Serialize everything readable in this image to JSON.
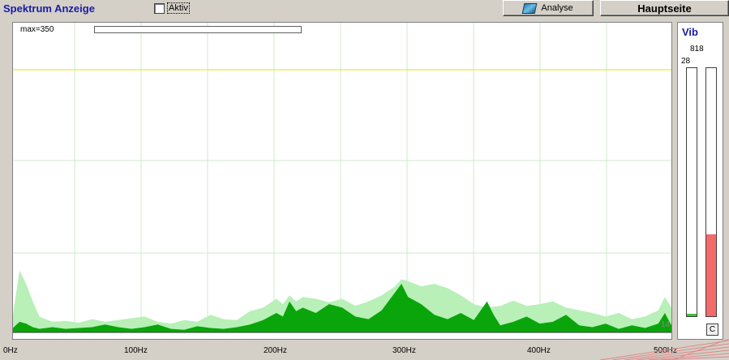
{
  "header": {
    "title": "Spektrum Anzeige",
    "aktiv_label": "Aktiv",
    "analyse_label": "Analyse",
    "hauptseite_label": "Hauptseite"
  },
  "spectrum": {
    "max_label": "max=350",
    "right_value": "14",
    "x_labels": [
      "0Hz",
      "100Hz",
      "200Hz",
      "300Hz",
      "400Hz",
      "500Hz"
    ]
  },
  "vib": {
    "title": "Vib",
    "value": "818",
    "small_value": "28",
    "bar1_level": 0.01,
    "bar2_level": 0.33,
    "clear_label": "C"
  },
  "chart_data": {
    "type": "area",
    "xlabel": "",
    "ylabel": "",
    "xlim": [
      0,
      500
    ],
    "ylim": [
      0,
      350
    ],
    "grid": true,
    "x_ticks": [
      0,
      100,
      200,
      300,
      400,
      500
    ],
    "series": [
      {
        "values": [
          [
            0,
            20
          ],
          [
            5,
            70
          ],
          [
            10,
            55
          ],
          [
            15,
            35
          ],
          [
            20,
            18
          ],
          [
            25,
            15
          ],
          [
            30,
            12
          ],
          [
            40,
            13
          ],
          [
            50,
            11
          ],
          [
            60,
            15
          ],
          [
            70,
            12
          ],
          [
            80,
            14
          ],
          [
            90,
            16
          ],
          [
            100,
            18
          ],
          [
            110,
            12
          ],
          [
            120,
            10
          ],
          [
            130,
            14
          ],
          [
            140,
            12
          ],
          [
            150,
            20
          ],
          [
            160,
            15
          ],
          [
            170,
            14
          ],
          [
            180,
            24
          ],
          [
            190,
            28
          ],
          [
            200,
            38
          ],
          [
            205,
            32
          ],
          [
            210,
            42
          ],
          [
            215,
            35
          ],
          [
            220,
            40
          ],
          [
            230,
            38
          ],
          [
            240,
            34
          ],
          [
            250,
            38
          ],
          [
            260,
            30
          ],
          [
            270,
            35
          ],
          [
            280,
            42
          ],
          [
            290,
            52
          ],
          [
            295,
            60
          ],
          [
            300,
            58
          ],
          [
            310,
            52
          ],
          [
            320,
            55
          ],
          [
            330,
            50
          ],
          [
            340,
            42
          ],
          [
            350,
            32
          ],
          [
            360,
            28
          ],
          [
            370,
            30
          ],
          [
            380,
            36
          ],
          [
            390,
            30
          ],
          [
            400,
            32
          ],
          [
            410,
            35
          ],
          [
            420,
            28
          ],
          [
            430,
            25
          ],
          [
            440,
            22
          ],
          [
            450,
            18
          ],
          [
            460,
            22
          ],
          [
            470,
            15
          ],
          [
            480,
            18
          ],
          [
            490,
            25
          ],
          [
            495,
            40
          ],
          [
            500,
            28
          ]
        ]
      },
      {
        "values": [
          [
            0,
            5
          ],
          [
            5,
            12
          ],
          [
            10,
            10
          ],
          [
            15,
            6
          ],
          [
            20,
            4
          ],
          [
            30,
            6
          ],
          [
            40,
            4
          ],
          [
            50,
            5
          ],
          [
            60,
            6
          ],
          [
            70,
            9
          ],
          [
            80,
            6
          ],
          [
            90,
            4
          ],
          [
            100,
            6
          ],
          [
            110,
            9
          ],
          [
            120,
            4
          ],
          [
            130,
            3
          ],
          [
            140,
            7
          ],
          [
            150,
            5
          ],
          [
            160,
            4
          ],
          [
            170,
            6
          ],
          [
            180,
            9
          ],
          [
            190,
            14
          ],
          [
            200,
            22
          ],
          [
            205,
            18
          ],
          [
            210,
            35
          ],
          [
            215,
            24
          ],
          [
            220,
            28
          ],
          [
            230,
            22
          ],
          [
            240,
            32
          ],
          [
            250,
            28
          ],
          [
            260,
            18
          ],
          [
            270,
            15
          ],
          [
            280,
            25
          ],
          [
            290,
            45
          ],
          [
            295,
            55
          ],
          [
            300,
            40
          ],
          [
            310,
            32
          ],
          [
            320,
            20
          ],
          [
            330,
            15
          ],
          [
            340,
            22
          ],
          [
            350,
            14
          ],
          [
            360,
            35
          ],
          [
            365,
            20
          ],
          [
            370,
            8
          ],
          [
            380,
            12
          ],
          [
            390,
            18
          ],
          [
            400,
            10
          ],
          [
            410,
            12
          ],
          [
            420,
            20
          ],
          [
            430,
            8
          ],
          [
            440,
            6
          ],
          [
            450,
            10
          ],
          [
            460,
            4
          ],
          [
            470,
            8
          ],
          [
            480,
            5
          ],
          [
            490,
            10
          ],
          [
            495,
            22
          ],
          [
            500,
            8
          ]
        ]
      }
    ]
  }
}
